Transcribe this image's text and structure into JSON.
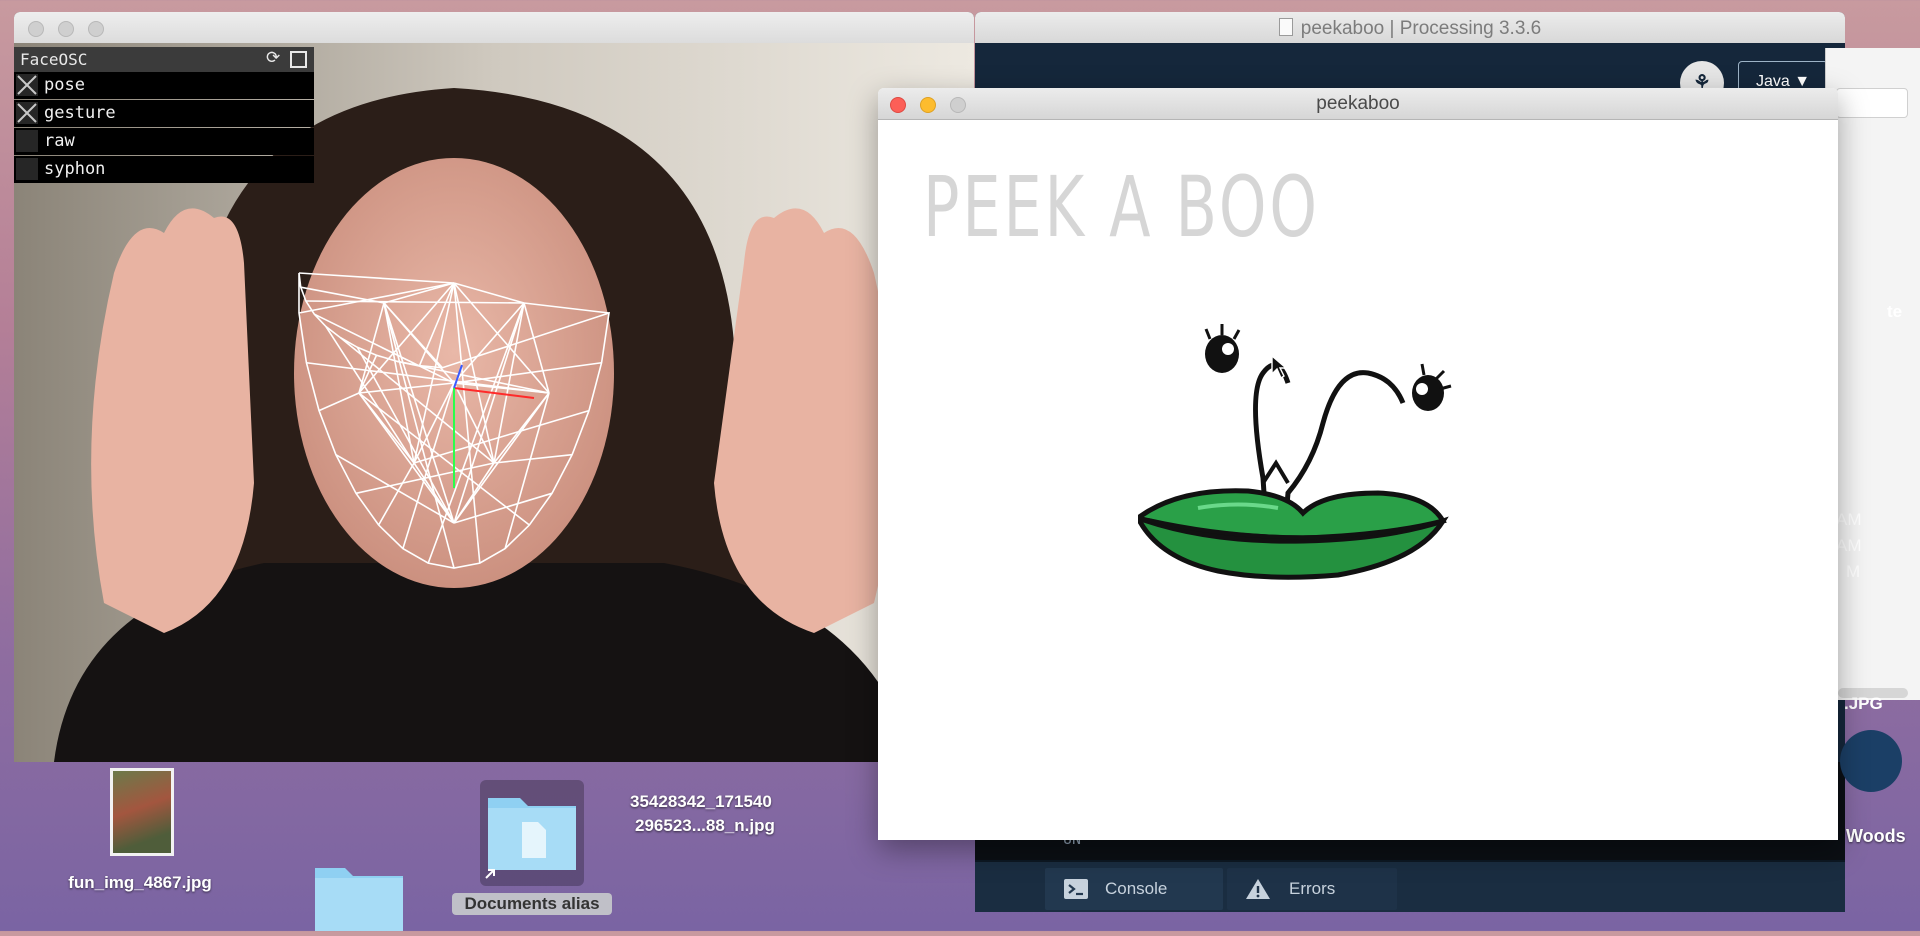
{
  "ide": {
    "title": "peekaboo | Processing 3.3.6",
    "mode_badge": "⚘",
    "mode": "Java ▼",
    "console_lines": [
      "UN",
      "UN",
      "UN"
    ],
    "tabs": {
      "console": "Console",
      "errors": "Errors"
    }
  },
  "faceosc": {
    "panel_title": "FaceOSC",
    "options": [
      {
        "label": "pose",
        "checked": true
      },
      {
        "label": "gesture",
        "checked": true
      },
      {
        "label": "raw",
        "checked": false
      },
      {
        "label": "syphon",
        "checked": false
      }
    ]
  },
  "sketch": {
    "window_title": "peekaboo",
    "canvas_title": "PEEK A BOO",
    "lips_color": "#2aa048"
  },
  "desktop": {
    "icons": [
      {
        "label": "fun_img_4867.jpg"
      },
      {
        "label": "35428342_171540"
      },
      {
        "label": "296523...88_n.jpg"
      },
      {
        "label": "Documents alias"
      }
    ],
    "edge_fragments": {
      "te": "te",
      "am1": "AM",
      "am2": "AM",
      "am3": "M",
      "jpg": ".JPG",
      "woods": "Woods"
    }
  }
}
